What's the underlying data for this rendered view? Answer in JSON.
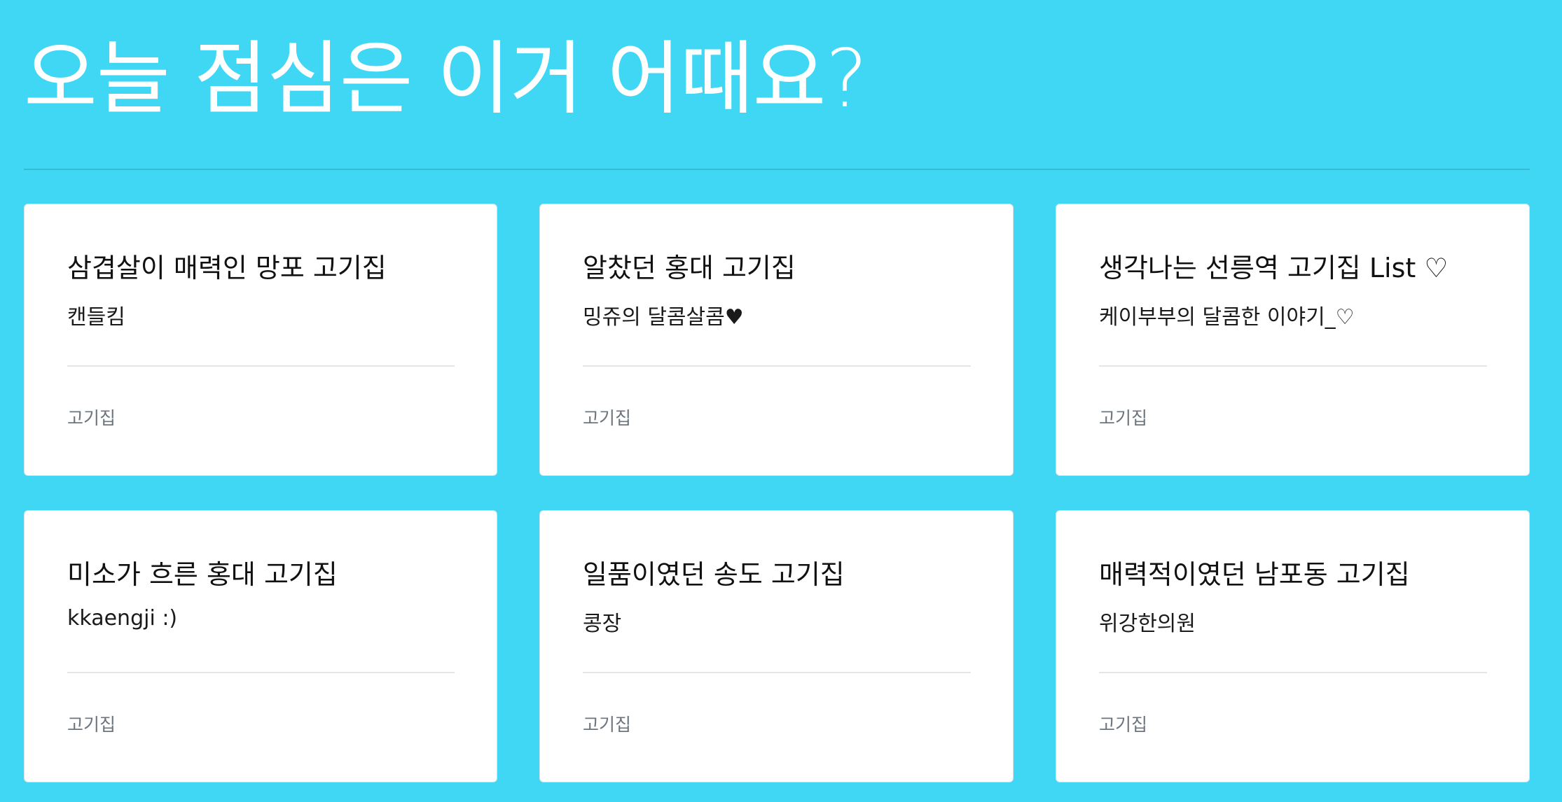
{
  "page": {
    "title": "오늘 점심은 이거 어때요?"
  },
  "cards": [
    {
      "title": "삼겹살이 매력인 망포 고기집",
      "author": "캔들킴",
      "tag": "고기집"
    },
    {
      "title": "알찼던 홍대 고기집",
      "author": "밍쥬의 달콤살콤♥",
      "tag": "고기집"
    },
    {
      "title": "생각나는 선릉역 고기집 List ♡",
      "author": "케이부부의 달콤한 이야기_♡",
      "tag": "고기집"
    },
    {
      "title": "미소가 흐른 홍대 고기집",
      "author": "kkaengji :)",
      "tag": "고기집"
    },
    {
      "title": "일품이였던 송도 고기집",
      "author": "콩장",
      "tag": "고기집"
    },
    {
      "title": "매력적이였던 남포동 고기집",
      "author": "위강한의원",
      "tag": "고기집"
    }
  ],
  "colors": {
    "background": "#3fd7f4",
    "card": "#ffffff",
    "tag_text": "#6c757d"
  }
}
